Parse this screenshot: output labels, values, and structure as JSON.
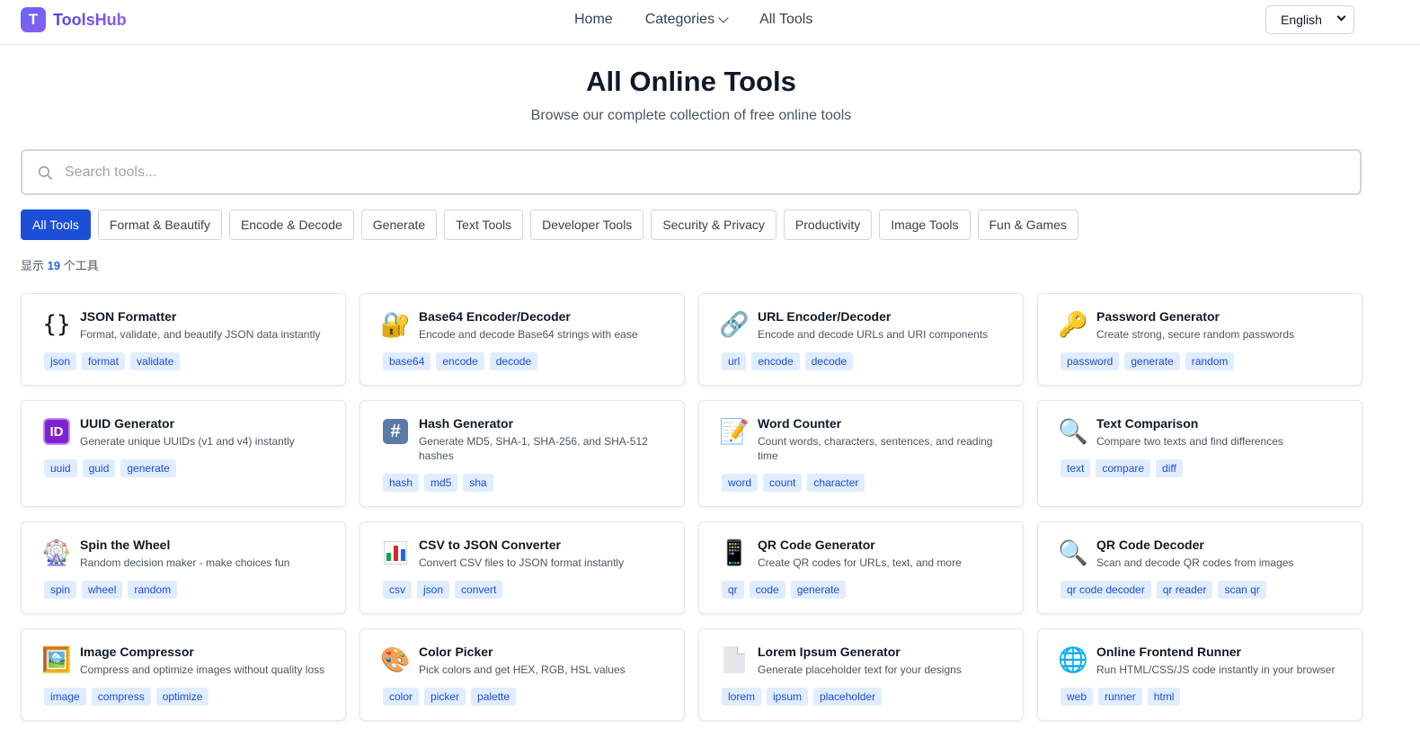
{
  "header": {
    "logo_letter": "T",
    "app_name": "ToolsHub",
    "nav": {
      "home": "Home",
      "categories": "Categories",
      "all_tools": "All Tools"
    },
    "language": "English"
  },
  "hero": {
    "title": "All Online Tools",
    "subtitle": "Browse our complete collection of free online tools"
  },
  "search": {
    "placeholder": "Search tools..."
  },
  "filters": [
    "All Tools",
    "Format & Beautify",
    "Encode & Decode",
    "Generate",
    "Text Tools",
    "Developer Tools",
    "Security & Privacy",
    "Productivity",
    "Image Tools",
    "Fun & Games"
  ],
  "active_filter": "All Tools",
  "count": {
    "prefix": "显示",
    "number": "19",
    "suffix": "个工具"
  },
  "tools": [
    {
      "name": "JSON Formatter",
      "desc": "Format, validate, and beautify JSON data instantly",
      "icon": "braces-icon",
      "tags": [
        "json",
        "format",
        "validate"
      ]
    },
    {
      "name": "Base64 Encoder/Decoder",
      "desc": "Encode and decode Base64 strings with ease",
      "icon": "lock-icon",
      "tags": [
        "base64",
        "encode",
        "decode"
      ]
    },
    {
      "name": "URL Encoder/Decoder",
      "desc": "Encode and decode URLs and URI components",
      "icon": "link-icon",
      "tags": [
        "url",
        "encode",
        "decode"
      ]
    },
    {
      "name": "Password Generator",
      "desc": "Create strong, secure random passwords",
      "icon": "key-icon",
      "tags": [
        "password",
        "generate",
        "random"
      ]
    },
    {
      "name": "UUID Generator",
      "desc": "Generate unique UUIDs (v1 and v4) instantly",
      "icon": "id-icon",
      "tags": [
        "uuid",
        "guid",
        "generate"
      ]
    },
    {
      "name": "Hash Generator",
      "desc": "Generate MD5, SHA-1, SHA-256, and SHA-512 hashes",
      "icon": "hash-icon",
      "tags": [
        "hash",
        "md5",
        "sha"
      ]
    },
    {
      "name": "Word Counter",
      "desc": "Count words, characters, sentences, and reading time",
      "icon": "memo-icon",
      "tags": [
        "word",
        "count",
        "character"
      ]
    },
    {
      "name": "Text Comparison",
      "desc": "Compare two texts and find differences",
      "icon": "magnifier-icon",
      "tags": [
        "text",
        "compare",
        "diff"
      ]
    },
    {
      "name": "Spin the Wheel",
      "desc": "Random decision maker - make choices fun",
      "icon": "ferris-wheel-icon",
      "tags": [
        "spin",
        "wheel",
        "random"
      ]
    },
    {
      "name": "CSV to JSON Converter",
      "desc": "Convert CSV files to JSON format instantly",
      "icon": "bar-chart-icon",
      "tags": [
        "csv",
        "json",
        "convert"
      ]
    },
    {
      "name": "QR Code Generator",
      "desc": "Create QR codes for URLs, text, and more",
      "icon": "phone-icon",
      "tags": [
        "qr",
        "code",
        "generate"
      ]
    },
    {
      "name": "QR Code Decoder",
      "desc": "Scan and decode QR codes from images",
      "icon": "magnifier-icon",
      "tags": [
        "qr code decoder",
        "qr reader",
        "scan qr"
      ]
    },
    {
      "name": "Image Compressor",
      "desc": "Compress and optimize images without quality loss",
      "icon": "picture-icon",
      "tags": [
        "image",
        "compress",
        "optimize"
      ]
    },
    {
      "name": "Color Picker",
      "desc": "Pick colors and get HEX, RGB, HSL values",
      "icon": "palette-icon",
      "tags": [
        "color",
        "picker",
        "palette"
      ]
    },
    {
      "name": "Lorem Ipsum Generator",
      "desc": "Generate placeholder text for your designs",
      "icon": "document-icon",
      "tags": [
        "lorem",
        "ipsum",
        "placeholder"
      ]
    },
    {
      "name": "Online Frontend Runner",
      "desc": "Run HTML/CSS/JS code instantly in your browser",
      "icon": "globe-icon",
      "tags": [
        "web",
        "runner",
        "html"
      ]
    }
  ],
  "colors": {
    "accent": "#1d4ed8",
    "tag_bg": "#e0ecff",
    "brand_start": "#6366f1",
    "brand_end": "#8b5cf6"
  }
}
